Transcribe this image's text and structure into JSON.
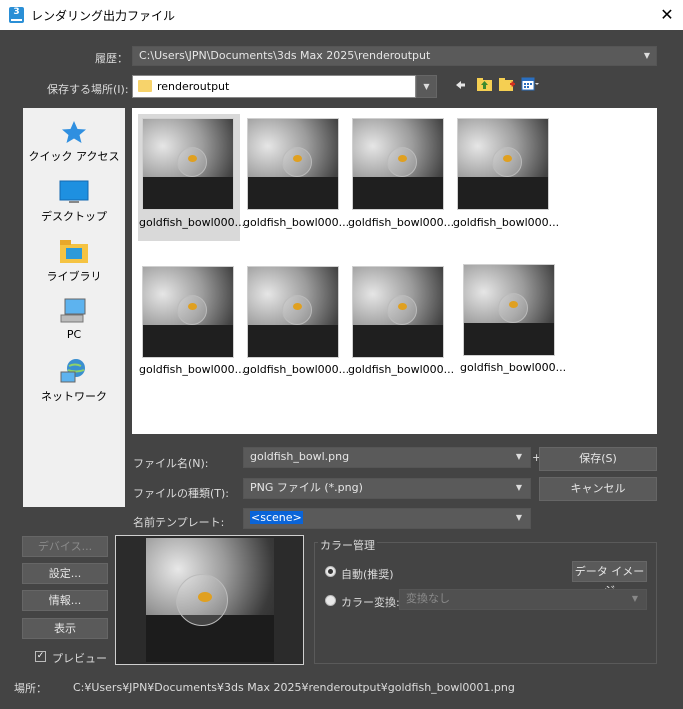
{
  "window": {
    "title": "レンダリング出力ファイル",
    "close_glyph": "✕",
    "app_icon_text": "3"
  },
  "history": {
    "label": "履歴：",
    "value": "C:\\Users\\JPN\\Documents\\3ds Max 2025\\renderoutput"
  },
  "save_in": {
    "label": "保存する場所(I):",
    "value": "renderoutput"
  },
  "toolbar_icons": [
    "back-arrow-icon",
    "up-folder-icon",
    "new-folder-icon",
    "view-menu-icon"
  ],
  "places": [
    {
      "id": "quick-access",
      "label": "クイック アクセス",
      "icon": "star-icon"
    },
    {
      "id": "desktop",
      "label": "デスクトップ",
      "icon": "desktop-icon"
    },
    {
      "id": "library",
      "label": "ライブラリ",
      "icon": "library-icon"
    },
    {
      "id": "pc",
      "label": "PC",
      "icon": "pc-icon"
    },
    {
      "id": "network",
      "label": "ネットワーク",
      "icon": "network-icon"
    }
  ],
  "files": [
    {
      "name": "goldfish_bowl000..."
    },
    {
      "name": "goldfish_bowl000..."
    },
    {
      "name": "goldfish_bowl000..."
    },
    {
      "name": "goldfish_bowl000..."
    },
    {
      "name": "goldfish_bowl000..."
    },
    {
      "name": "goldfish_bowl000..."
    },
    {
      "name": "goldfish_bowl000..."
    },
    {
      "name": "goldfish_bowl000..."
    }
  ],
  "filename": {
    "label": "ファイル名(N):",
    "value": "goldfish_bowl.png",
    "plus": "+"
  },
  "filetype": {
    "label": "ファイルの種類(T):",
    "value": "PNG ファイル (*.png)"
  },
  "name_template": {
    "label": "名前テンプレート:",
    "value": "<scene>"
  },
  "buttons": {
    "save": "保存(S)",
    "cancel": "キャンセル",
    "devices": "デバイス...",
    "setup": "設定...",
    "info": "情報...",
    "view": "表示"
  },
  "preview_check": {
    "label": "プレビュー",
    "checked": true
  },
  "color_management": {
    "title": "カラー管理",
    "auto_label": "自動(推奨)",
    "data_image_button": "データ イメージ",
    "convert_label": "カラー変換:",
    "convert_value": "変換なし"
  },
  "location": {
    "label": "場所：",
    "value": "C:¥Users¥JPN¥Documents¥3ds Max 2025¥renderoutput¥goldfish_bowl0001.png"
  }
}
